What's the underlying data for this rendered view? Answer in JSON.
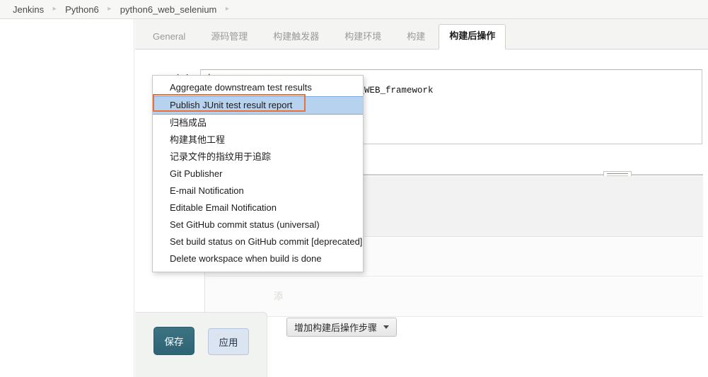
{
  "breadcrumb": {
    "items": [
      "Jenkins",
      "Python6",
      "python6_web_selenium"
    ],
    "separator": "▸",
    "trailing_separator": "▸"
  },
  "tabs": [
    {
      "label": "General",
      "active": false
    },
    {
      "label": "源码管理",
      "active": false
    },
    {
      "label": "构建触发器",
      "active": false
    },
    {
      "label": "构建环境",
      "active": false
    },
    {
      "label": "构建",
      "active": false
    },
    {
      "label": "构建后操作",
      "active": true
    }
  ],
  "command_row": {
    "label": "命令",
    "value": "d:\ncd D:\\python_workshop\\Python6_WEB_framework"
  },
  "ghost_glyph": "添",
  "add_step_button": {
    "label": "增加构建后操作步骤",
    "caret_icon": "chevron-down-icon"
  },
  "dropdown": {
    "items": [
      {
        "label": "Aggregate downstream test results",
        "selected": false
      },
      {
        "label": "Publish JUnit test result report",
        "selected": true
      },
      {
        "label": "归档成品",
        "selected": false
      },
      {
        "label": "构建其他工程",
        "selected": false
      },
      {
        "label": "记录文件的指纹用于追踪",
        "selected": false
      },
      {
        "label": "Git Publisher",
        "selected": false
      },
      {
        "label": "E-mail Notification",
        "selected": false
      },
      {
        "label": "Editable Email Notification",
        "selected": false
      },
      {
        "label": "Set GitHub commit status (universal)",
        "selected": false
      },
      {
        "label": "Set build status on GitHub commit [deprecated]",
        "selected": false
      },
      {
        "label": "Delete workspace when build is done",
        "selected": false
      }
    ]
  },
  "footer": {
    "save_label": "保存",
    "apply_label": "应用"
  },
  "colors": {
    "selected_row_bg": "#b6d2ef",
    "selected_row_border": "#7aa8da",
    "annotation": "#e8703a",
    "save_button": "#2e6374",
    "apply_button": "#dbe5f2",
    "tab_bar_bg": "#f4f4f2",
    "breadcrumb_bg": "#f7f7f5",
    "save_panel_bg": "#f0f3ef"
  }
}
